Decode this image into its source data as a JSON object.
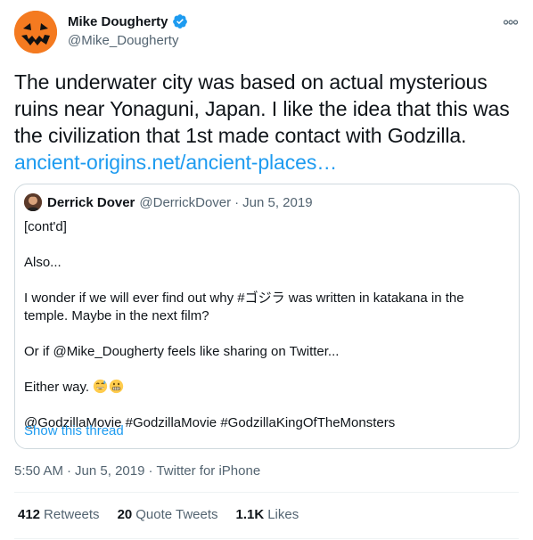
{
  "tweet": {
    "author": {
      "name": "Mike Dougherty",
      "handle": "@Mike_Dougherty",
      "avatar_icon": "jack-o-lantern-avatar",
      "verified": true
    },
    "text": "The underwater city was based on actual mysterious ruins near Yonaguni, Japan. I like the idea that this was the civilization that 1st made contact with Godzilla.",
    "link_text": "ancient-origins.net/ancient-places…",
    "quote": {
      "author_name": "Derrick Dover",
      "handle": "@DerrickDover",
      "separator": "·",
      "date": "Jun 5, 2019",
      "lines": [
        "[cont'd]",
        "Also...",
        "I wonder if we will ever find out why #ゴジラ was written in katakana in the temple. Maybe in the next film?",
        "Or if @Mike_Dougherty feels like sharing on Twitter...",
        "Either way.",
        "@GodzillaMovie #GodzillaMovie #GodzillaKingOfTheMonsters"
      ],
      "emojis": [
        "sweat-smile-emoji",
        "grimace-emoji"
      ],
      "show_thread": "Show this thread"
    },
    "meta": {
      "time": "5:50 AM",
      "separator": "·",
      "date": "Jun 5, 2019",
      "source": "Twitter for iPhone"
    },
    "stats": {
      "retweets_count": "412",
      "retweets_label": "Retweets",
      "quotes_count": "20",
      "quotes_label": "Quote Tweets",
      "likes_count": "1.1K",
      "likes_label": "Likes"
    },
    "colors": {
      "link": "#1d9bf0",
      "secondary_text": "#536471",
      "verified": "#1d9bf0",
      "avatar_orange": "#f47a20"
    }
  }
}
